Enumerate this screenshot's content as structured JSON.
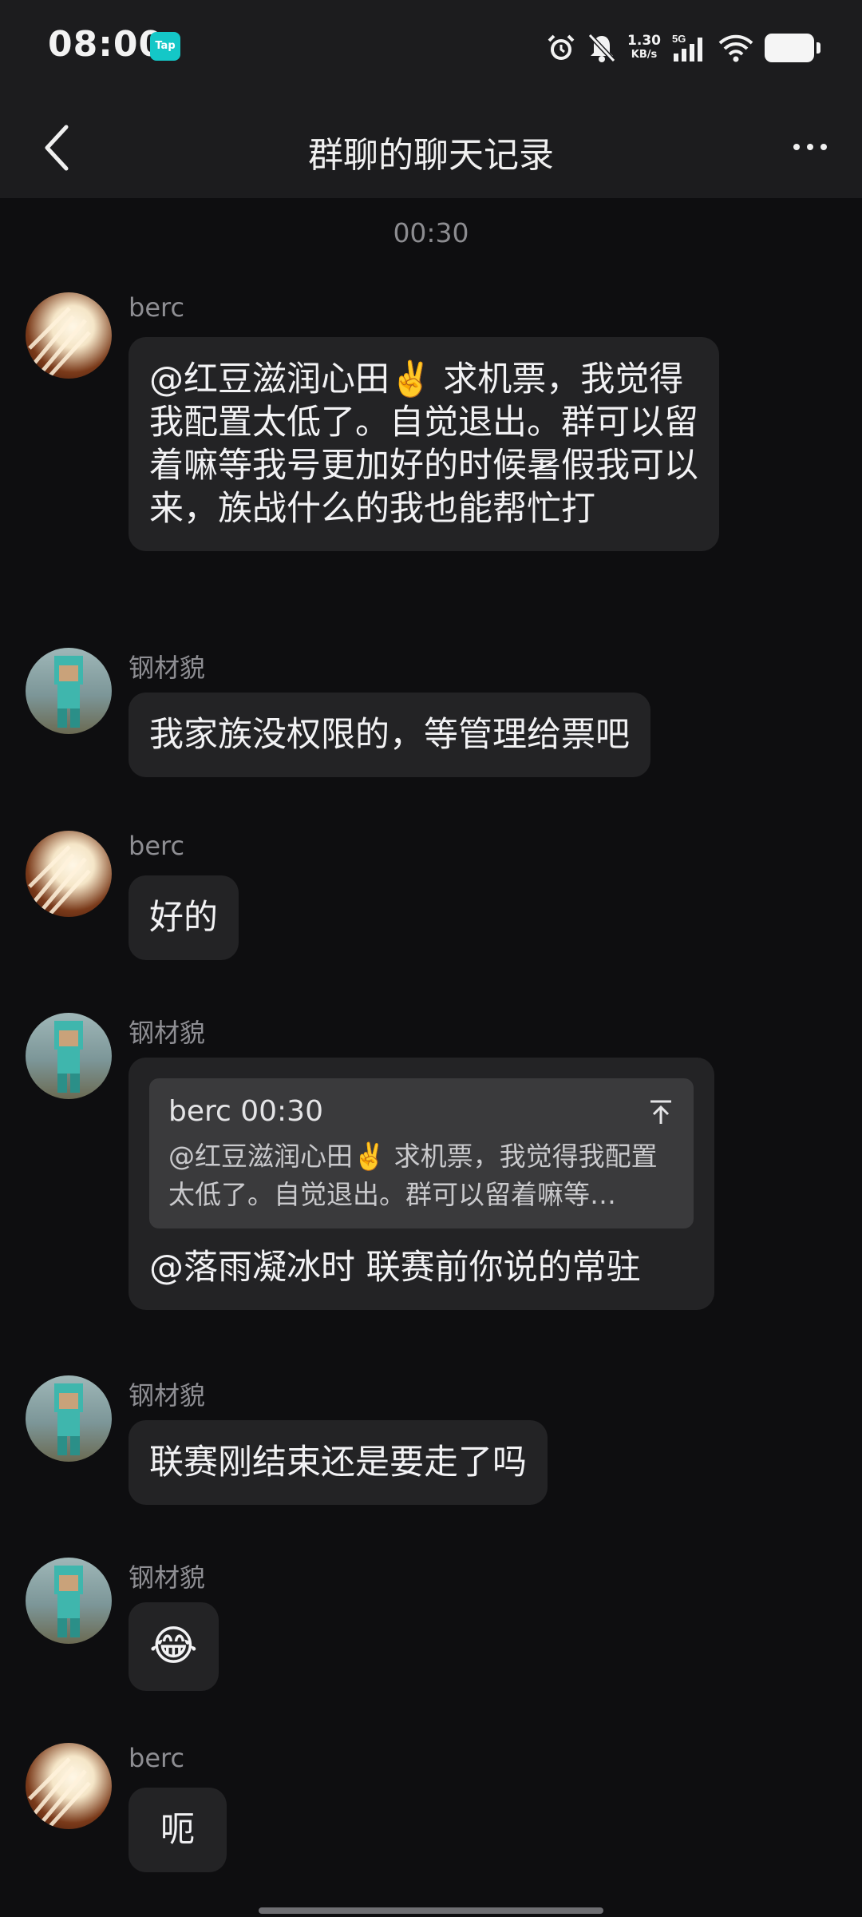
{
  "status_bar": {
    "time": "08:00",
    "tap_badge": "Tap",
    "net_speed_value": "1.30",
    "net_speed_unit": "KB/s",
    "network": "5G"
  },
  "nav": {
    "title": "群聊的聊天记录"
  },
  "chat": {
    "timestamp": "00:30",
    "messages": [
      {
        "sender": "berc",
        "text": "@红豆滋润心田✌️ 求机票，我觉得我配置太低了。自觉退出。群可以留着嘛等我号更加好的时候暑假我可以来，族战什么的我也能帮忙打"
      },
      {
        "sender": "钢材貌",
        "text": "我家族没权限的，等管理给票吧"
      },
      {
        "sender": "berc",
        "text": "好的"
      },
      {
        "sender": "钢材貌",
        "quote_header": "berc 00:30",
        "quote_text": "@红豆滋润心田✌️ 求机票，我觉得我配置太低了。自觉退出。群可以留着嘛等…",
        "text": "@落雨凝冰时 联赛前你说的常驻"
      },
      {
        "sender": "钢材貌",
        "text": "联赛刚结束还是要走了吗"
      },
      {
        "sender": "钢材貌",
        "text": "😂"
      },
      {
        "sender": "berc",
        "text": "呃"
      }
    ]
  },
  "icons": {
    "back": "chevron-left-icon",
    "more": "more-dots-icon",
    "alarm": "alarm-icon",
    "mute": "bell-off-icon",
    "signal": "signal-icon",
    "wifi": "wifi-icon",
    "battery": "battery-icon",
    "quote_jump": "arrow-up-to-top-icon"
  }
}
